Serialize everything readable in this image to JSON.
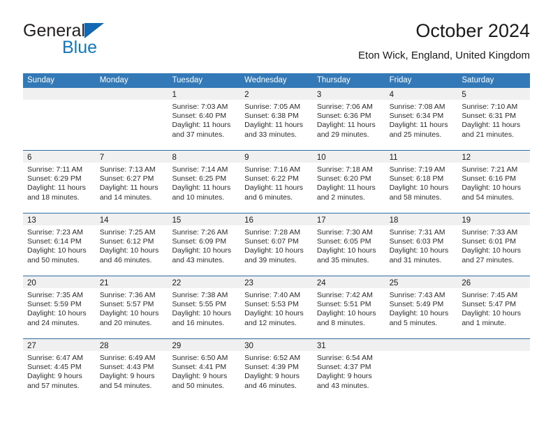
{
  "brand": {
    "word_general": "General",
    "word_blue": "Blue",
    "triangle_color": "#1268b3",
    "blue_color": "#1277bc"
  },
  "header": {
    "title": "October 2024",
    "subtitle": "Eton Wick, England, United Kingdom"
  },
  "theme": {
    "header_row_bg": "#3379b8",
    "week_border": "#2e6da4",
    "day_strip_bg": "#f0f0f0"
  },
  "weekdays": [
    "Sunday",
    "Monday",
    "Tuesday",
    "Wednesday",
    "Thursday",
    "Friday",
    "Saturday"
  ],
  "weeks": [
    [
      {
        "date": ""
      },
      {
        "date": ""
      },
      {
        "date": "1",
        "sunrise": "Sunrise: 7:03 AM",
        "sunset": "Sunset: 6:40 PM",
        "daylight1": "Daylight: 11 hours",
        "daylight2": "and 37 minutes."
      },
      {
        "date": "2",
        "sunrise": "Sunrise: 7:05 AM",
        "sunset": "Sunset: 6:38 PM",
        "daylight1": "Daylight: 11 hours",
        "daylight2": "and 33 minutes."
      },
      {
        "date": "3",
        "sunrise": "Sunrise: 7:06 AM",
        "sunset": "Sunset: 6:36 PM",
        "daylight1": "Daylight: 11 hours",
        "daylight2": "and 29 minutes."
      },
      {
        "date": "4",
        "sunrise": "Sunrise: 7:08 AM",
        "sunset": "Sunset: 6:34 PM",
        "daylight1": "Daylight: 11 hours",
        "daylight2": "and 25 minutes."
      },
      {
        "date": "5",
        "sunrise": "Sunrise: 7:10 AM",
        "sunset": "Sunset: 6:31 PM",
        "daylight1": "Daylight: 11 hours",
        "daylight2": "and 21 minutes."
      }
    ],
    [
      {
        "date": "6",
        "sunrise": "Sunrise: 7:11 AM",
        "sunset": "Sunset: 6:29 PM",
        "daylight1": "Daylight: 11 hours",
        "daylight2": "and 18 minutes."
      },
      {
        "date": "7",
        "sunrise": "Sunrise: 7:13 AM",
        "sunset": "Sunset: 6:27 PM",
        "daylight1": "Daylight: 11 hours",
        "daylight2": "and 14 minutes."
      },
      {
        "date": "8",
        "sunrise": "Sunrise: 7:14 AM",
        "sunset": "Sunset: 6:25 PM",
        "daylight1": "Daylight: 11 hours",
        "daylight2": "and 10 minutes."
      },
      {
        "date": "9",
        "sunrise": "Sunrise: 7:16 AM",
        "sunset": "Sunset: 6:22 PM",
        "daylight1": "Daylight: 11 hours",
        "daylight2": "and 6 minutes."
      },
      {
        "date": "10",
        "sunrise": "Sunrise: 7:18 AM",
        "sunset": "Sunset: 6:20 PM",
        "daylight1": "Daylight: 11 hours",
        "daylight2": "and 2 minutes."
      },
      {
        "date": "11",
        "sunrise": "Sunrise: 7:19 AM",
        "sunset": "Sunset: 6:18 PM",
        "daylight1": "Daylight: 10 hours",
        "daylight2": "and 58 minutes."
      },
      {
        "date": "12",
        "sunrise": "Sunrise: 7:21 AM",
        "sunset": "Sunset: 6:16 PM",
        "daylight1": "Daylight: 10 hours",
        "daylight2": "and 54 minutes."
      }
    ],
    [
      {
        "date": "13",
        "sunrise": "Sunrise: 7:23 AM",
        "sunset": "Sunset: 6:14 PM",
        "daylight1": "Daylight: 10 hours",
        "daylight2": "and 50 minutes."
      },
      {
        "date": "14",
        "sunrise": "Sunrise: 7:25 AM",
        "sunset": "Sunset: 6:12 PM",
        "daylight1": "Daylight: 10 hours",
        "daylight2": "and 46 minutes."
      },
      {
        "date": "15",
        "sunrise": "Sunrise: 7:26 AM",
        "sunset": "Sunset: 6:09 PM",
        "daylight1": "Daylight: 10 hours",
        "daylight2": "and 43 minutes."
      },
      {
        "date": "16",
        "sunrise": "Sunrise: 7:28 AM",
        "sunset": "Sunset: 6:07 PM",
        "daylight1": "Daylight: 10 hours",
        "daylight2": "and 39 minutes."
      },
      {
        "date": "17",
        "sunrise": "Sunrise: 7:30 AM",
        "sunset": "Sunset: 6:05 PM",
        "daylight1": "Daylight: 10 hours",
        "daylight2": "and 35 minutes."
      },
      {
        "date": "18",
        "sunrise": "Sunrise: 7:31 AM",
        "sunset": "Sunset: 6:03 PM",
        "daylight1": "Daylight: 10 hours",
        "daylight2": "and 31 minutes."
      },
      {
        "date": "19",
        "sunrise": "Sunrise: 7:33 AM",
        "sunset": "Sunset: 6:01 PM",
        "daylight1": "Daylight: 10 hours",
        "daylight2": "and 27 minutes."
      }
    ],
    [
      {
        "date": "20",
        "sunrise": "Sunrise: 7:35 AM",
        "sunset": "Sunset: 5:59 PM",
        "daylight1": "Daylight: 10 hours",
        "daylight2": "and 24 minutes."
      },
      {
        "date": "21",
        "sunrise": "Sunrise: 7:36 AM",
        "sunset": "Sunset: 5:57 PM",
        "daylight1": "Daylight: 10 hours",
        "daylight2": "and 20 minutes."
      },
      {
        "date": "22",
        "sunrise": "Sunrise: 7:38 AM",
        "sunset": "Sunset: 5:55 PM",
        "daylight1": "Daylight: 10 hours",
        "daylight2": "and 16 minutes."
      },
      {
        "date": "23",
        "sunrise": "Sunrise: 7:40 AM",
        "sunset": "Sunset: 5:53 PM",
        "daylight1": "Daylight: 10 hours",
        "daylight2": "and 12 minutes."
      },
      {
        "date": "24",
        "sunrise": "Sunrise: 7:42 AM",
        "sunset": "Sunset: 5:51 PM",
        "daylight1": "Daylight: 10 hours",
        "daylight2": "and 8 minutes."
      },
      {
        "date": "25",
        "sunrise": "Sunrise: 7:43 AM",
        "sunset": "Sunset: 5:49 PM",
        "daylight1": "Daylight: 10 hours",
        "daylight2": "and 5 minutes."
      },
      {
        "date": "26",
        "sunrise": "Sunrise: 7:45 AM",
        "sunset": "Sunset: 5:47 PM",
        "daylight1": "Daylight: 10 hours",
        "daylight2": "and 1 minute."
      }
    ],
    [
      {
        "date": "27",
        "sunrise": "Sunrise: 6:47 AM",
        "sunset": "Sunset: 4:45 PM",
        "daylight1": "Daylight: 9 hours",
        "daylight2": "and 57 minutes."
      },
      {
        "date": "28",
        "sunrise": "Sunrise: 6:49 AM",
        "sunset": "Sunset: 4:43 PM",
        "daylight1": "Daylight: 9 hours",
        "daylight2": "and 54 minutes."
      },
      {
        "date": "29",
        "sunrise": "Sunrise: 6:50 AM",
        "sunset": "Sunset: 4:41 PM",
        "daylight1": "Daylight: 9 hours",
        "daylight2": "and 50 minutes."
      },
      {
        "date": "30",
        "sunrise": "Sunrise: 6:52 AM",
        "sunset": "Sunset: 4:39 PM",
        "daylight1": "Daylight: 9 hours",
        "daylight2": "and 46 minutes."
      },
      {
        "date": "31",
        "sunrise": "Sunrise: 6:54 AM",
        "sunset": "Sunset: 4:37 PM",
        "daylight1": "Daylight: 9 hours",
        "daylight2": "and 43 minutes."
      },
      {
        "date": ""
      },
      {
        "date": ""
      }
    ]
  ]
}
